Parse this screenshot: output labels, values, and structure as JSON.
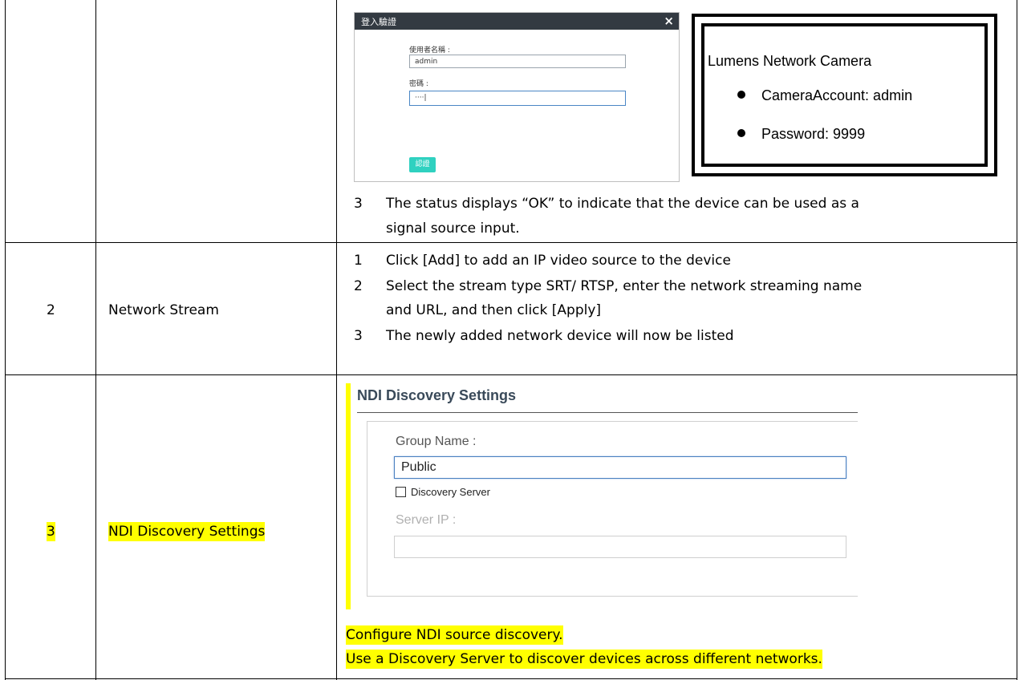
{
  "row1": {
    "dialog": {
      "title": "登入驗證",
      "close_glyph": "×",
      "username_label": "使用者名稱 :",
      "username_value": "admin",
      "password_label": "密碼 :",
      "password_value": "····|",
      "submit_label": "認證"
    },
    "credentials": {
      "title": "Lumens Network Camera",
      "account": "CameraAccount: admin",
      "password": "Password: 9999"
    },
    "step3_num": "3",
    "step3_line1": "The status displays “OK” to indicate that the device can be used as a",
    "step3_line2": "signal source input."
  },
  "row2": {
    "num": "2",
    "name": "Network Stream",
    "steps": [
      {
        "num": "1",
        "line1": "Click [Add] to add an IP video source to the device",
        "line2": ""
      },
      {
        "num": "2",
        "line1": "Select the stream type SRT/ RTSP, enter the network streaming name",
        "line2": "and URL, and then click [Apply]"
      },
      {
        "num": "3",
        "line1": "The newly added network device will now be listed",
        "line2": ""
      }
    ]
  },
  "row3": {
    "num": "3",
    "name": "NDI Discovery Settings",
    "panel": {
      "heading": "NDI Discovery Settings",
      "group_label": "Group Name :",
      "group_value": "Public",
      "checkbox_label": "Discovery Server",
      "server_label": "Server IP :",
      "server_value": ""
    },
    "desc_line1": "Configure NDI source discovery.",
    "desc_line2": "Use a Discovery Server to discover devices across different networks."
  },
  "colors": {
    "highlight": "#ffff00",
    "dialog_title_bg": "#333a42",
    "confirm_button": "#2fd1c0"
  }
}
